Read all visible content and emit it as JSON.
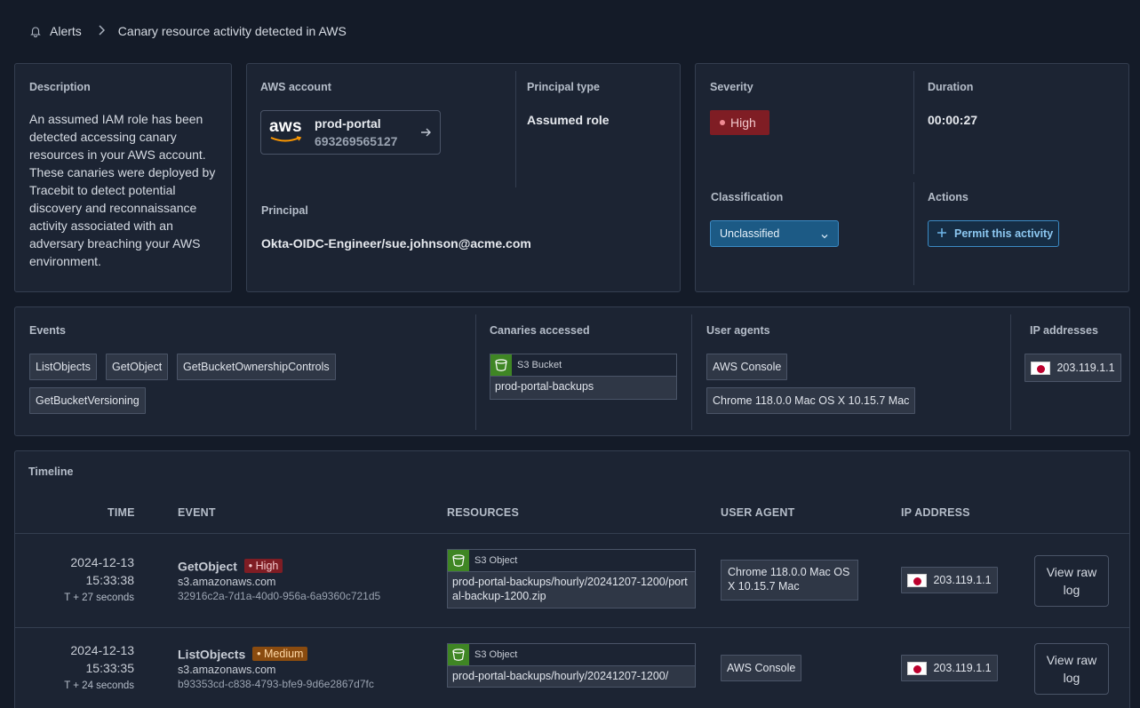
{
  "breadcrumb": {
    "root": "Alerts",
    "current": "Canary resource activity detected in AWS"
  },
  "description": {
    "label": "Description",
    "text": "An assumed IAM role has been detected accessing canary resources in your AWS account. These canaries were deployed by Tracebit to detect potential discovery and reconnaissance activity associated with an adversary breaching your AWS environment."
  },
  "account": {
    "label": "AWS account",
    "logo_text": "aws",
    "name": "prod-portal",
    "id": "693269565127",
    "principal_type_label": "Principal type",
    "principal_type": "Assumed role",
    "principal_label": "Principal",
    "principal": "Okta-OIDC-Engineer/sue.johnson@acme.com"
  },
  "status": {
    "severity_label": "Severity",
    "severity": "High",
    "duration_label": "Duration",
    "duration": "00:00:27",
    "classification_label": "Classification",
    "classification": "Unclassified",
    "actions_label": "Actions",
    "permit_button": "Permit this activity"
  },
  "summary": {
    "events_label": "Events",
    "events": [
      "ListObjects",
      "GetObject",
      "GetBucketOwnershipControls",
      "GetBucketVersioning"
    ],
    "canaries_label": "Canaries accessed",
    "canary_type": "S3 Bucket",
    "canary_name": "prod-portal-backups",
    "agents_label": "User agents",
    "agents": [
      "AWS Console",
      "Chrome 118.0.0 Mac OS X 10.15.7 Mac"
    ],
    "ips_label": "IP addresses",
    "ip": "203.119.1.1"
  },
  "timeline": {
    "label": "Timeline",
    "headers": {
      "time": "TIME",
      "event": "EVENT",
      "resources": "RESOURCES",
      "agent": "USER AGENT",
      "ip": "IP ADDRESS"
    },
    "rows": [
      {
        "date": "2024-12-13",
        "time": "15:33:38",
        "offset": "T + 27 seconds",
        "event": "GetObject",
        "severity": "High",
        "service": "s3.amazonaws.com",
        "request_id": "32916c2a-7d1a-40d0-956a-6a9360c721d5",
        "resource_type": "S3 Object",
        "resource": "prod-portal-backups/hourly/20241207-1200/portal-backup-1200.zip",
        "agent": "Chrome 118.0.0 Mac OS X 10.15.7 Mac",
        "ip": "203.119.1.1",
        "button": "View raw log"
      },
      {
        "date": "2024-12-13",
        "time": "15:33:35",
        "offset": "T + 24 seconds",
        "event": "ListObjects",
        "severity": "Medium",
        "service": "s3.amazonaws.com",
        "request_id": "b93353cd-c838-4793-bfe9-9d6e2867d7fc",
        "resource_type": "S3 Object",
        "resource": "prod-portal-backups/hourly/20241207-1200/",
        "agent": "AWS Console",
        "ip": "203.119.1.1",
        "button": "View raw log"
      }
    ]
  },
  "colors": {
    "background": "#141b28",
    "card": "#1c2433",
    "high": "#7f1d24",
    "medium": "#8a4b0f",
    "accent": "#1c5a85",
    "aws_orange": "#ff9900",
    "s3_green": "#3f8624"
  }
}
